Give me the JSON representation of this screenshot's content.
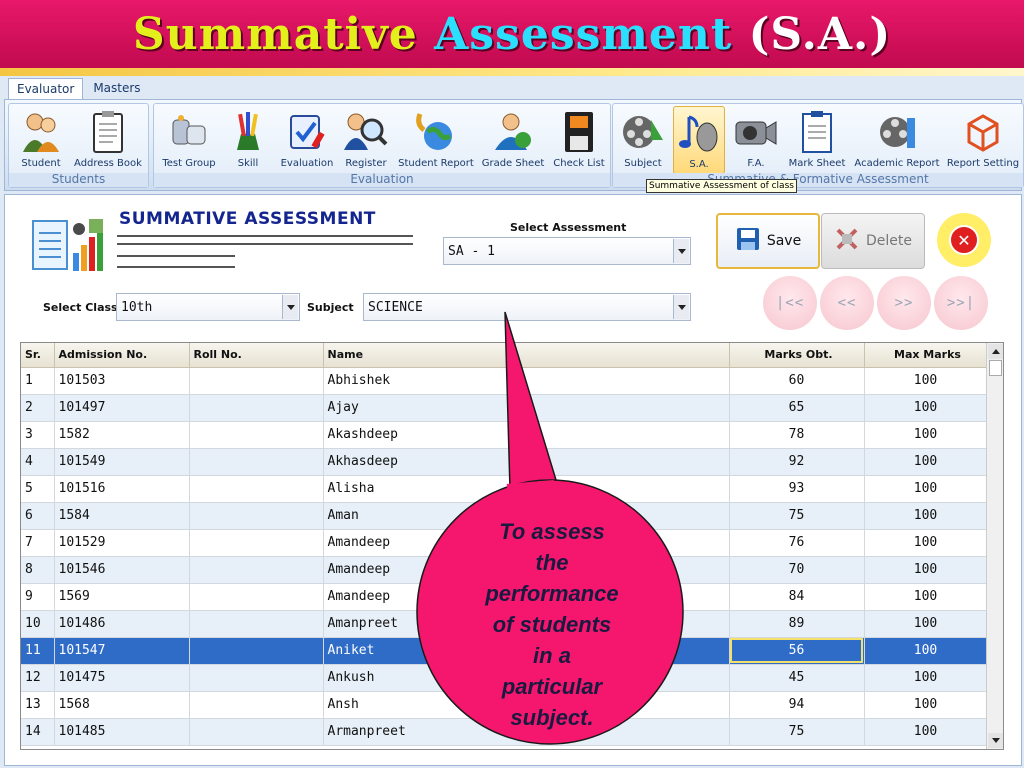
{
  "banner": {
    "part1": "Summative",
    "part2": "Assessment",
    "part3": "(S.A.)"
  },
  "ribbon": {
    "tabs": [
      "Evaluator",
      "Masters"
    ],
    "groups": {
      "students": {
        "label": "Students",
        "items": [
          "Student",
          "Address Book"
        ]
      },
      "evaluation": {
        "label": "Evaluation",
        "items": [
          "Test Group",
          "Skill",
          "Evaluation",
          "Register",
          "Student Report",
          "Grade Sheet",
          "Check List"
        ]
      },
      "sfa": {
        "label": "Summative & Formative Assessment",
        "items": [
          "Subject",
          "S.A.",
          "F.A.",
          "Mark Sheet",
          "Academic Report",
          "Report Setting"
        ]
      }
    },
    "tooltip": "Summative Assessment of class"
  },
  "form": {
    "heading": "SUMMATIVE ASSESSMENT",
    "select_assessment_label": "Select Assessment",
    "select_assessment_value": "SA - 1",
    "select_class_label": "Select Class",
    "select_class_value": "10th",
    "subject_label": "Subject",
    "subject_value": "SCIENCE",
    "save_label": "Save",
    "delete_label": "Delete",
    "close_glyph": "✕",
    "nav": [
      "|<<",
      "<<",
      ">>",
      ">>|"
    ]
  },
  "grid": {
    "columns": [
      "Sr.",
      "Admission No.",
      "Roll No.",
      "Name",
      "Marks Obt.",
      "Max Marks"
    ],
    "rows": [
      [
        "1",
        "101503",
        "",
        "Abhishek",
        "60",
        "100"
      ],
      [
        "2",
        "101497",
        "",
        "Ajay",
        "65",
        "100"
      ],
      [
        "3",
        "1582",
        "",
        "Akashdeep",
        "78",
        "100"
      ],
      [
        "4",
        "101549",
        "",
        "Akhasdeep",
        "92",
        "100"
      ],
      [
        "5",
        "101516",
        "",
        "Alisha",
        "93",
        "100"
      ],
      [
        "6",
        "1584",
        "",
        "Aman",
        "75",
        "100"
      ],
      [
        "7",
        "101529",
        "",
        "Amandeep",
        "76",
        "100"
      ],
      [
        "8",
        "101546",
        "",
        "Amandeep",
        "70",
        "100"
      ],
      [
        "9",
        "1569",
        "",
        "Amandeep",
        "84",
        "100"
      ],
      [
        "10",
        "101486",
        "",
        "Amanpreet",
        "89",
        "100"
      ],
      [
        "11",
        "101547",
        "",
        "Aniket",
        "56",
        "100"
      ],
      [
        "12",
        "101475",
        "",
        "Ankush",
        "45",
        "100"
      ],
      [
        "13",
        "1568",
        "",
        "Ansh",
        "94",
        "100"
      ],
      [
        "14",
        "101485",
        "",
        "Armanpreet",
        "75",
        "100"
      ]
    ],
    "selected_row": 10
  },
  "callout": {
    "lines": [
      "To assess",
      "the",
      "performance",
      "of students",
      "in a",
      "particular",
      "subject."
    ]
  },
  "colors": {
    "banner": "#e8186a",
    "callout": "#f5176e",
    "selection": "#2f6cc8",
    "heading": "#14258f"
  }
}
